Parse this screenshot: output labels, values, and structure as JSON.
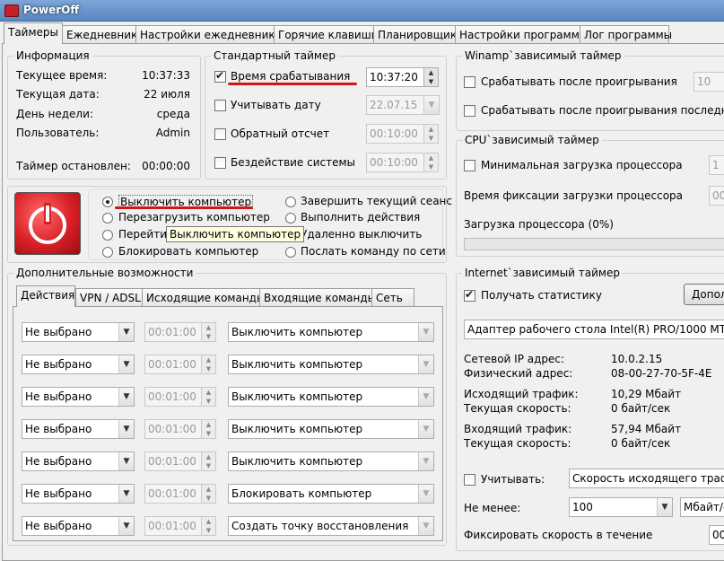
{
  "window": {
    "title": "PowerOff"
  },
  "tabs": [
    "Таймеры",
    "Ежедневник",
    "Настройки ежедневника",
    "Горячие клавиши",
    "Планировщик",
    "Настройки программы",
    "Лог программы"
  ],
  "info": {
    "title": "Информация",
    "time_label": "Текущее время:",
    "time_value": "10:37:33",
    "date_label": "Текущая дата:",
    "date_value": "22 июля",
    "weekday_label": "День недели:",
    "weekday_value": "среда",
    "user_label": "Пользователь:",
    "user_value": "Admin",
    "timer_status_label": "Таймер остановлен:",
    "timer_status_value": "00:00:00"
  },
  "std_timer": {
    "title": "Стандартный таймер",
    "trigger_time_label": "Время срабатывания",
    "trigger_time_value": "10:37:20",
    "consider_date_label": "Учитывать дату",
    "consider_date_value": "22.07.15",
    "countdown_label": "Обратный отсчет",
    "countdown_value": "00:10:00",
    "idle_label": "Бездействие системы",
    "idle_value": "00:10:00"
  },
  "actions": {
    "left": [
      "Выключить компьютер",
      "Перезагрузить компьютер",
      "Перейти в",
      "Блокировать компьютер"
    ],
    "right": [
      "Завершить текущий сеанс",
      "Выполнить действия",
      "Удаленно выключить",
      "Послать команду по сети"
    ],
    "tooltip": "Выключить компьютер"
  },
  "extra": {
    "title": "Дополнительные возможности",
    "tabs": [
      "Действия",
      "VPN / ADSL",
      "Исходящие команды",
      "Входящие команды",
      "Сеть"
    ],
    "rows": [
      {
        "trigger": "Не выбрано",
        "time": "00:01:00",
        "action": "Выключить компьютер"
      },
      {
        "trigger": "Не выбрано",
        "time": "00:01:00",
        "action": "Выключить компьютер"
      },
      {
        "trigger": "Не выбрано",
        "time": "00:01:00",
        "action": "Выключить компьютер"
      },
      {
        "trigger": "Не выбрано",
        "time": "00:01:00",
        "action": "Выключить компьютер"
      },
      {
        "trigger": "Не выбрано",
        "time": "00:01:00",
        "action": "Выключить компьютер"
      },
      {
        "trigger": "Не выбрано",
        "time": "00:01:00",
        "action": "Блокировать компьютер"
      },
      {
        "trigger": "Не выбрано",
        "time": "00:01:00",
        "action": "Создать точку восстановления"
      }
    ]
  },
  "winamp": {
    "title": "Winamp`зависимый таймер",
    "after_play_label": "Срабатывать после проигрывания",
    "after_play_value": "10",
    "after_last_label": "Срабатывать после проигрывания последнего"
  },
  "cpu": {
    "title": "CPU`зависимый таймер",
    "min_load_label": "Минимальная загрузка процессора",
    "min_load_value": "1",
    "fix_time_label": "Время фиксации загрузки процессора",
    "fix_time_value": "00",
    "load_label": "Загрузка процессора (0%)",
    "load_fraction": 0
  },
  "internet": {
    "title": "Internet`зависимый таймер",
    "stats_label": "Получать статистику",
    "more_button": "Допол",
    "adapter": "Адаптер рабочего стола Intel(R) PRO/1000 MT",
    "ip_label": "Сетевой IP адрес:",
    "ip_value": "10.0.2.15",
    "mac_label": "Физический адрес:",
    "mac_value": "08-00-27-70-5F-4E",
    "out_label": "Исходящий трафик:",
    "out_value": "10,29 Мбайт",
    "out_speed_label": "Текущая скорость:",
    "out_speed_value": "0 байт/сек",
    "in_label": "Входящий трафик:",
    "in_value": "57,94 Мбайт",
    "in_speed_label": "Текущая скорость:",
    "in_speed_value": "0 байт/сек",
    "consider_label": "Учитывать:",
    "consider_value": "Скорость исходящего трафи",
    "min_label": "Не менее:",
    "min_value": "100",
    "unit_value": "Мбайт/с",
    "fix_label": "Фиксировать скорость в течение",
    "fix_value": "00"
  },
  "colors": {
    "power_red": "#d81f26",
    "title_blue": "#5a86c0",
    "annotation_red": "#d01818"
  }
}
